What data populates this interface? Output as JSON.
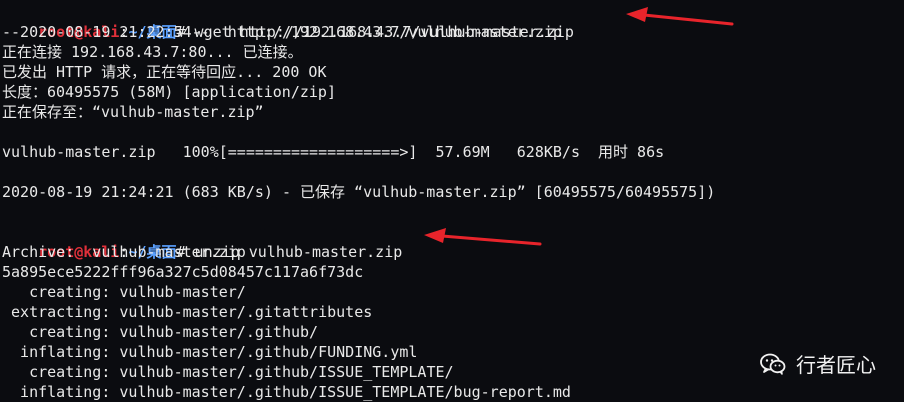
{
  "prompt": {
    "user": "root",
    "at": "@",
    "host": "kali",
    "colon": ":",
    "path": "~/桌面",
    "symbol": "#"
  },
  "commands": {
    "wget": " wget http://192.168.43.7/vulhub-master.zip",
    "unzip": " unzip vulhub-master.zip"
  },
  "output": {
    "wget_lines": [
      "--2020-08-19 21:22:54--  http://192.168.43.7/vulhub-master.zip",
      "正在连接 192.168.43.7:80... 已连接。",
      "已发出 HTTP 请求，正在等待回应... 200 OK",
      "长度：60495575 (58M) [application/zip]",
      "正在保存至：“vulhub-master.zip”",
      "",
      "vulhub-master.zip   100%[===================>]  57.69M   628KB/s  用时 86s",
      "",
      "2020-08-19 21:24:21 (683 KB/s) - 已保存 “vulhub-master.zip” [60495575/60495575])",
      ""
    ],
    "unzip_lines": [
      "Archive:  vulhub-master.zip",
      "5a895ece5222fff96a327c5d08457c117a6f73dc",
      "   creating: vulhub-master/",
      " extracting: vulhub-master/.gitattributes",
      "   creating: vulhub-master/.github/",
      "  inflating: vulhub-master/.github/FUNDING.yml",
      "   creating: vulhub-master/.github/ISSUE_TEMPLATE/",
      "  inflating: vulhub-master/.github/ISSUE_TEMPLATE/bug-report.md"
    ]
  },
  "watermark": {
    "text": "行者匠心",
    "icon": "wechat-icon"
  },
  "colors": {
    "background": "#0b0c10",
    "prompt_user": "#e0303a",
    "prompt_path": "#5aa0ff",
    "text": "#e9e9e9",
    "arrow": "#e8242b"
  }
}
